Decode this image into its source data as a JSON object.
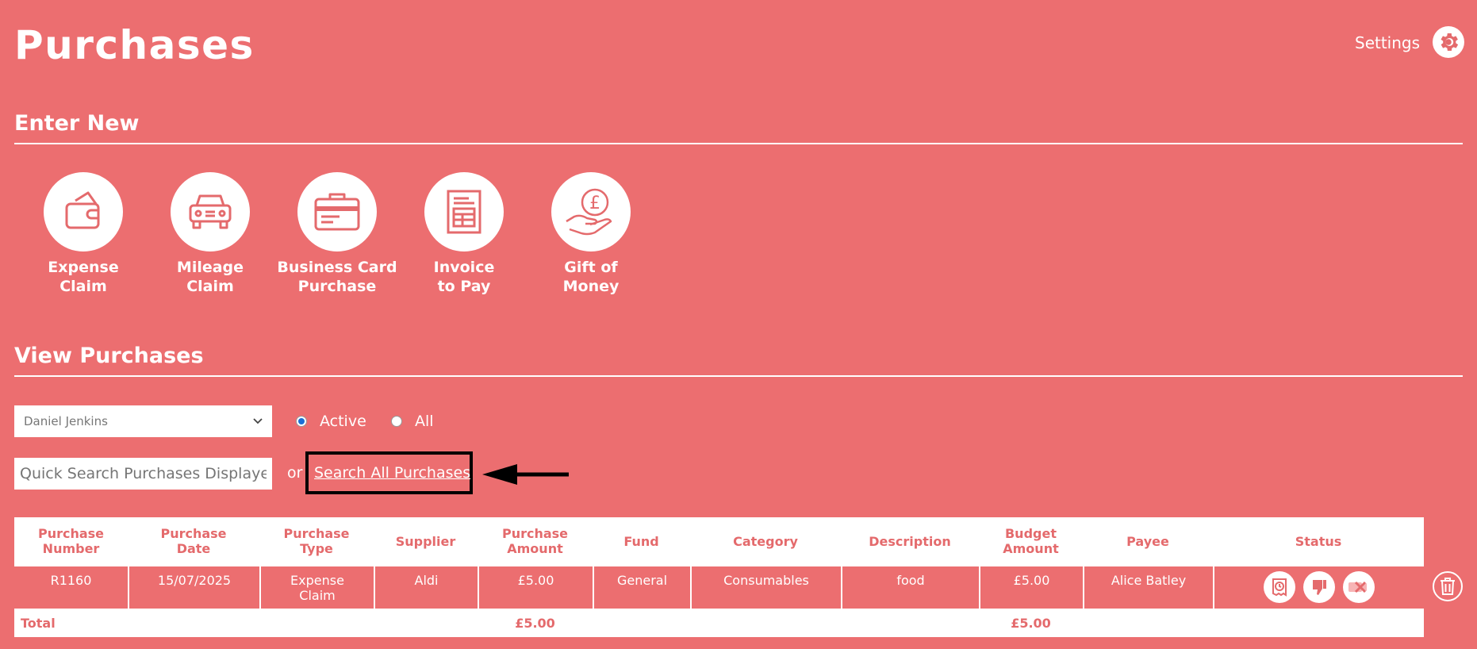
{
  "header": {
    "title": "Purchases",
    "settings_label": "Settings",
    "settings_icon": "gear-icon"
  },
  "enter_new": {
    "heading": "Enter New",
    "tiles": [
      {
        "line1": "Expense",
        "line2": "Claim",
        "icon": "wallet-icon"
      },
      {
        "line1": "Mileage",
        "line2": "Claim",
        "icon": "car-icon"
      },
      {
        "line1": "Business Card",
        "line2": "Purchase",
        "icon": "credit-card-icon"
      },
      {
        "line1": "Invoice",
        "line2": "to Pay",
        "icon": "invoice-icon"
      },
      {
        "line1": "Gift of",
        "line2": "Money",
        "icon": "hand-pound-icon"
      }
    ]
  },
  "view": {
    "heading": "View Purchases",
    "user_select": {
      "value": "Daniel Jenkins"
    },
    "filter": {
      "active_label": "Active",
      "all_label": "All",
      "selected": "Active"
    },
    "search": {
      "placeholder": "Quick Search Purchases Displayed",
      "or_text": "or",
      "link_label": "Search All Purchases"
    }
  },
  "table": {
    "headers": {
      "number": [
        "Purchase",
        "Number"
      ],
      "date": [
        "Purchase",
        "Date"
      ],
      "type": [
        "Purchase",
        "Type"
      ],
      "supplier": "Supplier",
      "amount": [
        "Purchase",
        "Amount"
      ],
      "fund": "Fund",
      "category": "Category",
      "description": "Description",
      "budget": [
        "Budget",
        "Amount"
      ],
      "payee": "Payee",
      "status": "Status"
    },
    "rows": [
      {
        "number": "R1160",
        "date": "15/07/2025",
        "type_line1": "Expense",
        "type_line2": "Claim",
        "supplier": "Aldi",
        "amount": "£5.00",
        "fund": "General",
        "category": "Consumables",
        "description": "food",
        "budget": "£5.00",
        "payee": "Alice Batley",
        "status_icons": [
          "receipt-clock-icon",
          "thumbs-down-icon",
          "video-cancel-icon"
        ]
      }
    ],
    "total": {
      "label": "Total",
      "amount": "£5.00",
      "budget": "£5.00"
    }
  },
  "colors": {
    "background": "#ec6e70",
    "accent_text": "#e46a6c",
    "radio_checked": "#1a6fd6"
  }
}
